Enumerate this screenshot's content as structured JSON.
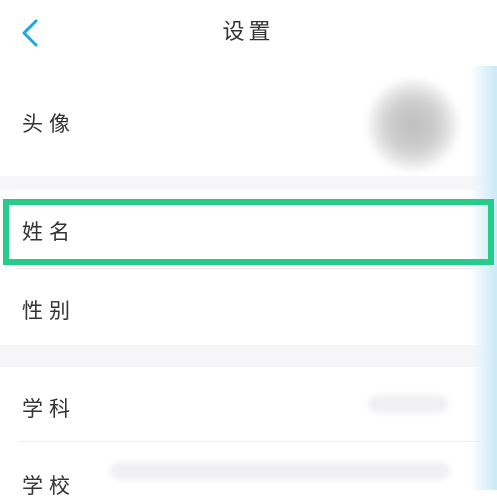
{
  "header": {
    "title": "设置",
    "back_icon": "chevron-left-icon",
    "accent_color": "#1ba8e0"
  },
  "rows": {
    "avatar": {
      "label": "头像"
    },
    "name": {
      "label": "姓名"
    },
    "gender": {
      "label": "性别"
    },
    "subject": {
      "label": "学科"
    },
    "school": {
      "label": "学校"
    }
  },
  "highlight": {
    "target": "name",
    "color": "#27cc8b"
  }
}
